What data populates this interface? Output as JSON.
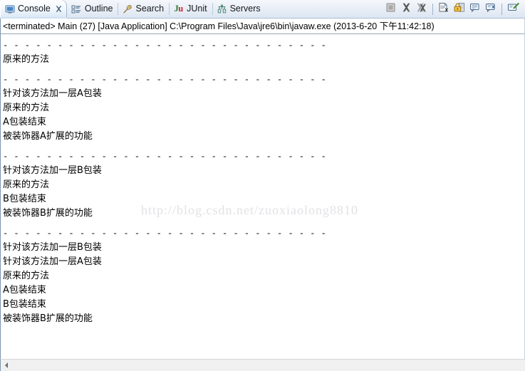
{
  "window": {
    "title": "Console"
  },
  "tabs": [
    {
      "label": "Console",
      "icon": "console-monitor-icon",
      "active": true,
      "closable": true
    },
    {
      "label": "Outline",
      "icon": "outline-icon",
      "active": false,
      "closable": false
    },
    {
      "label": "Search",
      "icon": "search-pin-icon",
      "active": false,
      "closable": false
    },
    {
      "label": "JUnit",
      "icon": "junit-icon",
      "active": false,
      "closable": false
    },
    {
      "label": "Servers",
      "icon": "servers-icon",
      "active": false,
      "closable": false
    }
  ],
  "toolbar": {
    "buttons": [
      {
        "name": "terminate-button",
        "icon": "stop-square-icon",
        "tooltip": "Terminate"
      },
      {
        "name": "remove-launch-button",
        "icon": "remove-x-icon",
        "tooltip": "Remove Launch"
      },
      {
        "name": "remove-all-terminated-button",
        "icon": "remove-all-x-icon",
        "tooltip": "Remove All Terminated Launches"
      },
      {
        "name": "clear-console-button",
        "icon": "clear-console-icon",
        "tooltip": "Clear Console"
      },
      {
        "name": "scroll-lock-button",
        "icon": "lock-icon",
        "tooltip": "Scroll Lock"
      },
      {
        "name": "pin-console-button",
        "icon": "pin-console-icon",
        "tooltip": "Pin Console"
      },
      {
        "name": "display-selected-console-button",
        "icon": "display-console-icon",
        "tooltip": "Display Selected Console"
      },
      {
        "name": "open-console-button",
        "icon": "open-console-pencil-icon",
        "tooltip": "Open Console"
      }
    ]
  },
  "console": {
    "header": "<terminated> Main (27) [Java Application] C:\\Program Files\\Java\\jre6\\bin\\javaw.exe (2013-6-20 下午11:42:18)",
    "separator": "- - - - - - - - - - - - - - - - - - - - - - - - - - - - - -",
    "lines": [
      {
        "type": "sep"
      },
      {
        "type": "text",
        "text": "原来的方法"
      },
      {
        "type": "blank"
      },
      {
        "type": "sep"
      },
      {
        "type": "text",
        "text": "针对该方法加一层A包装"
      },
      {
        "type": "text",
        "text": "原来的方法"
      },
      {
        "type": "text",
        "text": "A包装结束"
      },
      {
        "type": "text",
        "text": "被装饰器A扩展的功能"
      },
      {
        "type": "blank"
      },
      {
        "type": "sep"
      },
      {
        "type": "text",
        "text": "针对该方法加一层B包装"
      },
      {
        "type": "text",
        "text": "原来的方法"
      },
      {
        "type": "text",
        "text": "B包装结束"
      },
      {
        "type": "text",
        "text": "被装饰器B扩展的功能"
      },
      {
        "type": "blank"
      },
      {
        "type": "sep"
      },
      {
        "type": "text",
        "text": "针对该方法加一层B包装"
      },
      {
        "type": "text",
        "text": "针对该方法加一层A包装"
      },
      {
        "type": "text",
        "text": "原来的方法"
      },
      {
        "type": "text",
        "text": "A包装结束"
      },
      {
        "type": "text",
        "text": "B包装结束"
      },
      {
        "type": "text",
        "text": "被装饰器B扩展的功能"
      }
    ],
    "watermark": "http://blog.csdn.net/zuoxiaolong8810"
  },
  "colors": {
    "tab_active_bg": "#ffffff",
    "tabbar_bg": "#e8eef6",
    "tabbar_border": "#a8bed4",
    "console_bg": "#ffffff",
    "console_text": "#000000",
    "watermark": "#e2e2e6",
    "junit_j": "#2e7d32",
    "junit_u": "#c62828"
  }
}
